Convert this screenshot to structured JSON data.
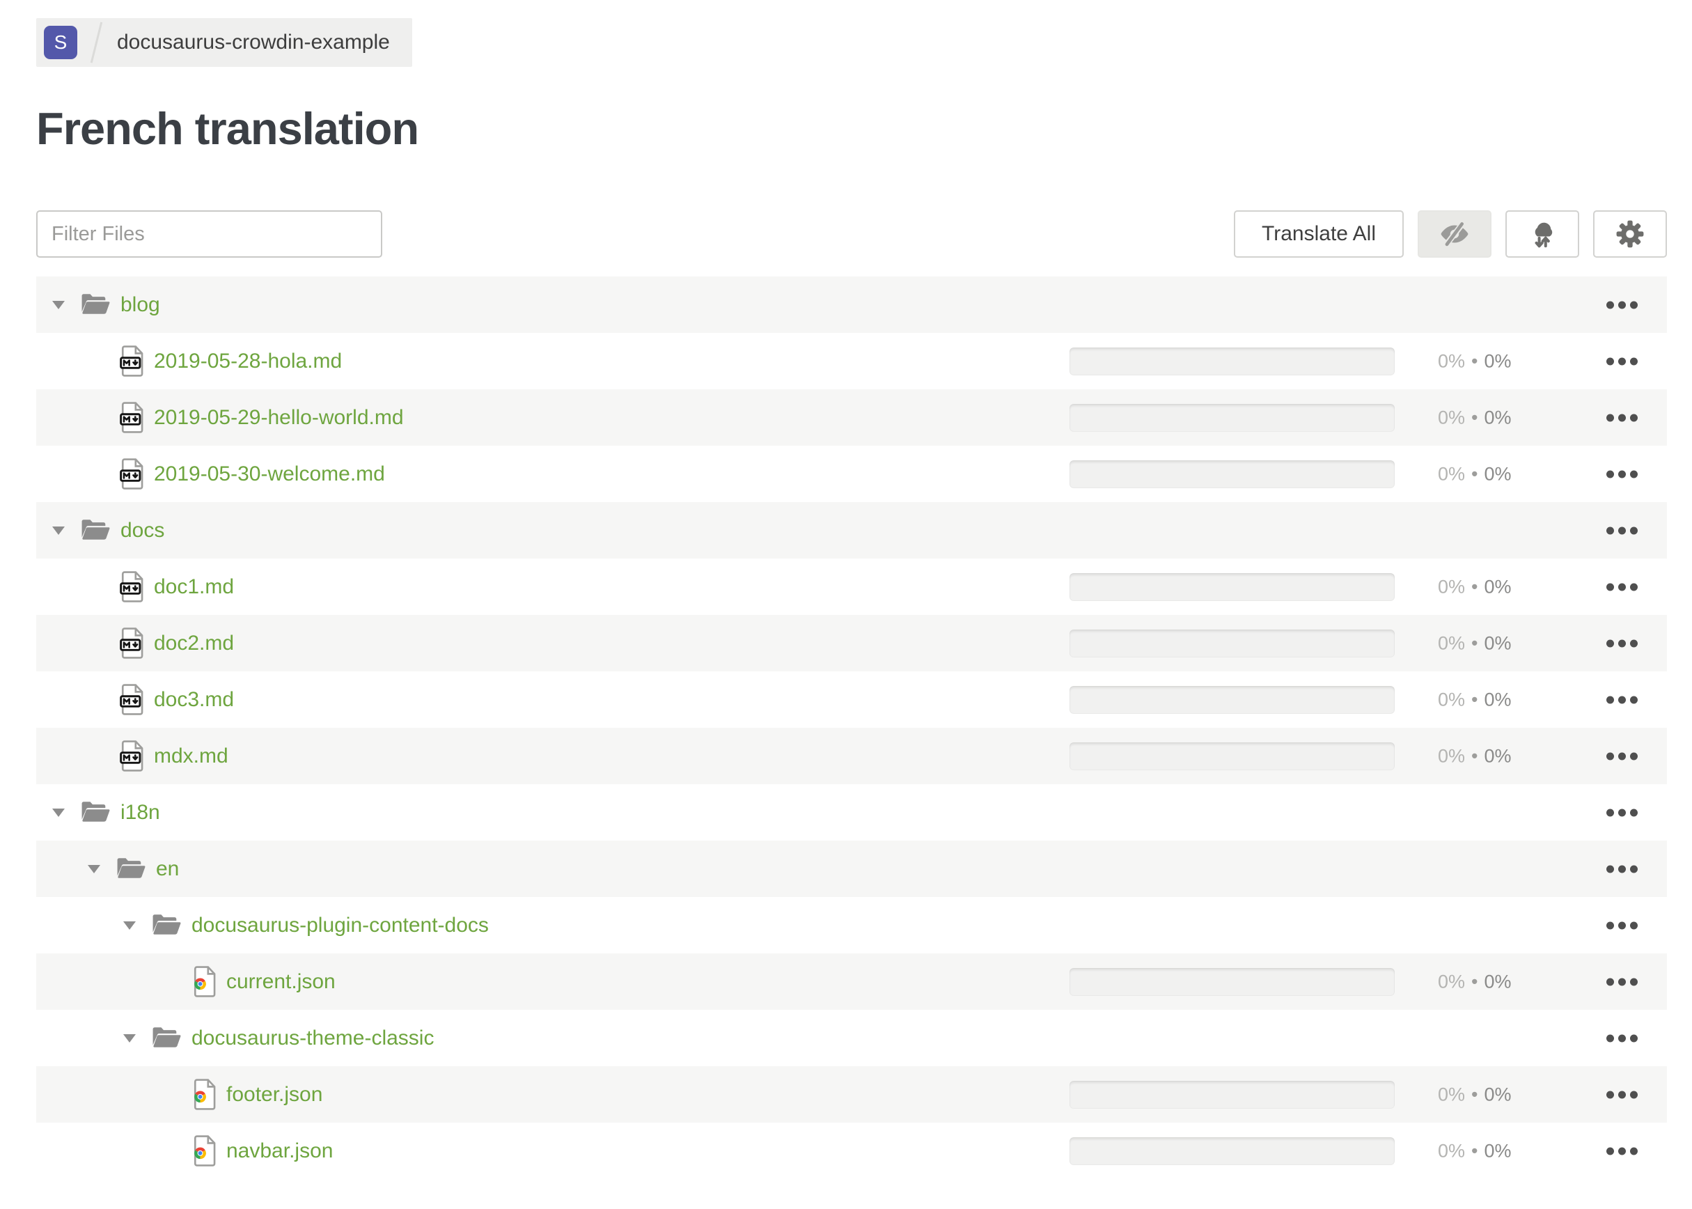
{
  "breadcrumb": {
    "badge": "S",
    "project": "docusaurus-crowdin-example"
  },
  "page": {
    "title": "French translation"
  },
  "toolbar": {
    "filter_placeholder": "Filter Files",
    "buttons": [
      {
        "name": "translate-all",
        "label": "Translate All"
      },
      {
        "name": "toggle-hidden-files",
        "icon": "eye-slash-icon",
        "active": true
      },
      {
        "name": "download-upload",
        "icon": "cloud-sync-icon"
      },
      {
        "name": "settings",
        "icon": "gear-icon"
      }
    ]
  },
  "colors": {
    "accent-green": "#6ea53f",
    "badge-indigo": "#5358aa",
    "row-stripe": "#f6f6f5",
    "breadcrumb-bg": "#efefee",
    "icon-gray": "#8c8c8c",
    "chrome-red": "#ea4335",
    "chrome-green": "#34a853",
    "chrome-yellow": "#fbbc05",
    "chrome-blue": "#4285f4"
  },
  "tree": {
    "separator": "•",
    "rows": [
      {
        "type": "folder",
        "level": 0,
        "label": "blog",
        "expanded": true
      },
      {
        "type": "file",
        "kind": "markdown",
        "level": 1,
        "label": "2019-05-28-hola.md",
        "progress": {
          "translated": "0%",
          "approved": "0%"
        }
      },
      {
        "type": "file",
        "kind": "markdown",
        "level": 1,
        "label": "2019-05-29-hello-world.md",
        "progress": {
          "translated": "0%",
          "approved": "0%"
        }
      },
      {
        "type": "file",
        "kind": "markdown",
        "level": 1,
        "label": "2019-05-30-welcome.md",
        "progress": {
          "translated": "0%",
          "approved": "0%"
        }
      },
      {
        "type": "folder",
        "level": 0,
        "label": "docs",
        "expanded": true
      },
      {
        "type": "file",
        "kind": "markdown",
        "level": 1,
        "label": "doc1.md",
        "progress": {
          "translated": "0%",
          "approved": "0%"
        }
      },
      {
        "type": "file",
        "kind": "markdown",
        "level": 1,
        "label": "doc2.md",
        "progress": {
          "translated": "0%",
          "approved": "0%"
        }
      },
      {
        "type": "file",
        "kind": "markdown",
        "level": 1,
        "label": "doc3.md",
        "progress": {
          "translated": "0%",
          "approved": "0%"
        }
      },
      {
        "type": "file",
        "kind": "markdown",
        "level": 1,
        "label": "mdx.md",
        "progress": {
          "translated": "0%",
          "approved": "0%"
        }
      },
      {
        "type": "folder",
        "level": 0,
        "label": "i18n",
        "expanded": true
      },
      {
        "type": "folder",
        "level": 1,
        "label": "en",
        "expanded": true
      },
      {
        "type": "folder",
        "level": 2,
        "label": "docusaurus-plugin-content-docs",
        "expanded": true
      },
      {
        "type": "file",
        "kind": "json",
        "level": 3,
        "label": "current.json",
        "progress": {
          "translated": "0%",
          "approved": "0%"
        }
      },
      {
        "type": "folder",
        "level": 2,
        "label": "docusaurus-theme-classic",
        "expanded": true
      },
      {
        "type": "file",
        "kind": "json",
        "level": 3,
        "label": "footer.json",
        "progress": {
          "translated": "0%",
          "approved": "0%"
        }
      },
      {
        "type": "file",
        "kind": "json",
        "level": 3,
        "label": "navbar.json",
        "progress": {
          "translated": "0%",
          "approved": "0%"
        }
      }
    ]
  }
}
